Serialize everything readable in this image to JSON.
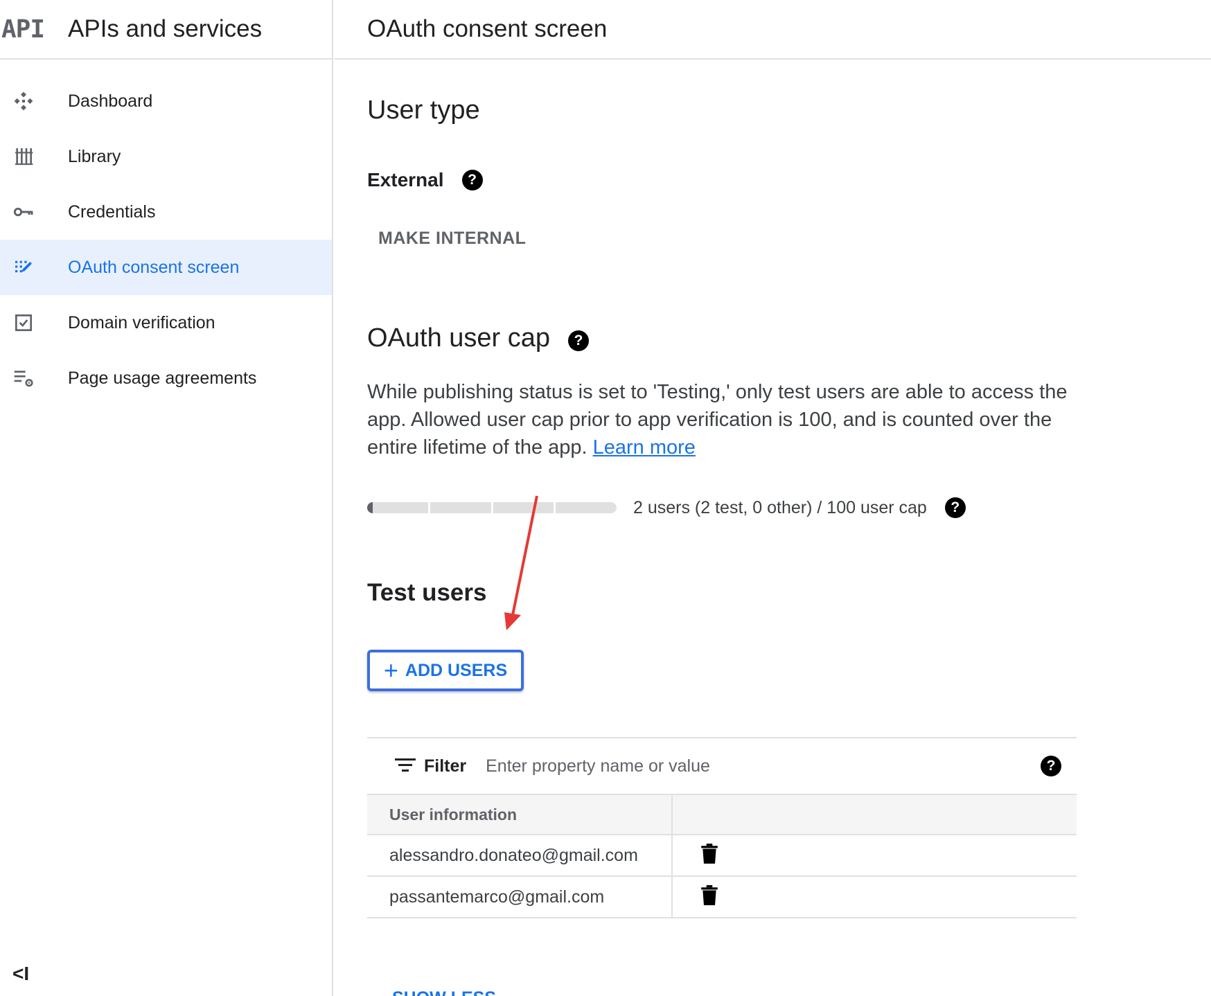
{
  "sidebar": {
    "logo": "API",
    "title": "APIs and services",
    "items": [
      {
        "label": "Dashboard",
        "icon": "dashboard-icon"
      },
      {
        "label": "Library",
        "icon": "library-icon"
      },
      {
        "label": "Credentials",
        "icon": "key-icon"
      },
      {
        "label": "OAuth consent screen",
        "icon": "oauth-consent-icon",
        "active": true
      },
      {
        "label": "Domain verification",
        "icon": "checkbox-icon"
      },
      {
        "label": "Page usage agreements",
        "icon": "settings-list-icon"
      }
    ],
    "collapse_label": "<I"
  },
  "header": {
    "title": "OAuth consent screen"
  },
  "user_type": {
    "title": "User type",
    "value": "External",
    "make_internal_label": "MAKE INTERNAL"
  },
  "user_cap": {
    "title": "OAuth user cap",
    "description": "While publishing status is set to 'Testing,' only test users are able to access the app. Allowed user cap prior to app verification is 100, and is counted over the entire lifetime of the app.",
    "learn_more": "Learn more",
    "progress_fraction": 0.02,
    "progress_text": "2 users (2 test, 0 other) / 100 user cap"
  },
  "test_users": {
    "title": "Test users",
    "add_users_label": "ADD USERS",
    "filter_label": "Filter",
    "filter_placeholder": "Enter property name or value",
    "column_user_info": "User information",
    "rows": [
      {
        "email": "alessandro.donateo@gmail.com"
      },
      {
        "email": "passantemarco@gmail.com"
      }
    ],
    "show_less_label": "SHOW LESS"
  },
  "colors": {
    "accent": "#1a73e8",
    "active_bg": "#e8f0fe",
    "annotation_arrow": "#e53935"
  }
}
